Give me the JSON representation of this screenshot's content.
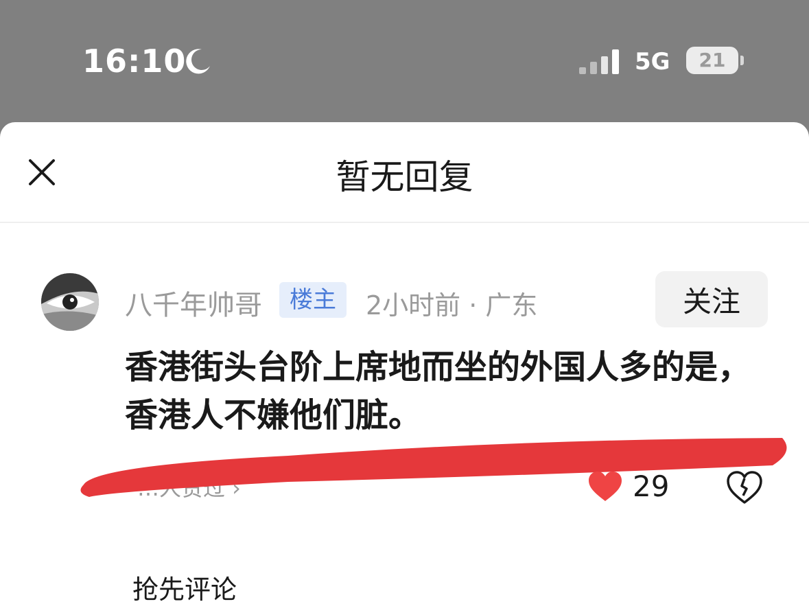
{
  "status_bar": {
    "time": "16:10",
    "network": "5G",
    "battery_level": "21",
    "icons": [
      "moon-icon",
      "signal-icon",
      "battery-icon"
    ]
  },
  "sheet": {
    "title": "暂无回复",
    "close_icon": "close-icon"
  },
  "comment": {
    "author": "八千年帅哥",
    "badge": "楼主",
    "meta": "2小时前 · 广东",
    "follow_label": "关注",
    "text": "香港街头台阶上席地而坐的外国人多的是，香港人不嫌他们脏。",
    "views_link": "…人赞过 ›",
    "like_count": "29",
    "like_color": "#ef4444",
    "annotation_color": "#e5383b"
  },
  "footer": {
    "first_comment_label": "抢先评论"
  }
}
